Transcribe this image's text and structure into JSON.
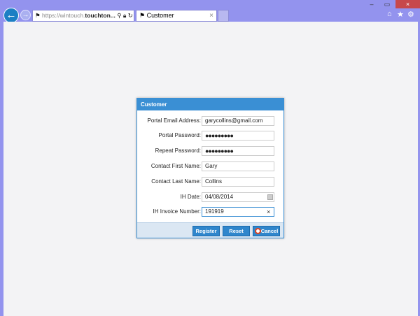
{
  "browser": {
    "url_prefix": "https://",
    "url_host_light": "wintouch.",
    "url_host_bold": "touchton...",
    "tab_title": "Customer",
    "tab_close": "×",
    "window_controls": {
      "minimize": "–",
      "maximize": "▭",
      "close": "×"
    },
    "toolbar_icons": [
      "home-icon",
      "star-icon",
      "gear-icon"
    ]
  },
  "dialog": {
    "title": "Customer",
    "fields": [
      {
        "label": "Portal Email Address:",
        "value": "garycollins@gmail.com"
      },
      {
        "label": "Portal Password:",
        "value": "●●●●●●●●●"
      },
      {
        "label": "Repeat Password:",
        "value": "●●●●●●●●●"
      },
      {
        "label": "Contact First Name:",
        "value": "Gary"
      },
      {
        "label": "Contact Last Name:",
        "value": "Collins"
      },
      {
        "label": "IH Date:",
        "value": "04/08/2014"
      },
      {
        "label": "IH Invoice Number:",
        "value": "191919"
      }
    ],
    "clear_icon": "×",
    "buttons": {
      "register": "Register",
      "reset": "Reset",
      "cancel": "Cancel"
    }
  }
}
